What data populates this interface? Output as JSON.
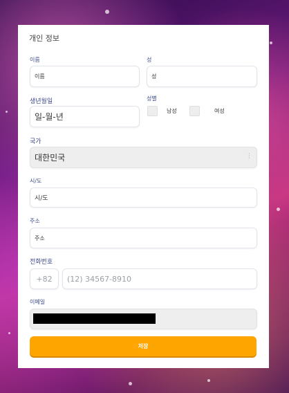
{
  "form": {
    "title": "개인 정보",
    "first_name": {
      "label": "이름",
      "placeholder": "이름"
    },
    "last_name": {
      "label": "성",
      "placeholder": "성"
    },
    "birthdate": {
      "label": "생년월일",
      "placeholder": "일-월-년"
    },
    "gender": {
      "label": "성별",
      "options": [
        "남성",
        "여성"
      ]
    },
    "country": {
      "label": "국가",
      "value": "대한민국"
    },
    "city": {
      "label": "시/도",
      "value": "시/도"
    },
    "address": {
      "label": "주소",
      "placeholder": "주소"
    },
    "phone": {
      "label": "전화번호",
      "code": "+82",
      "placeholder": "(12) 34567-8910"
    },
    "email": {
      "label": "이메일",
      "value": ""
    },
    "save_label": "저장"
  },
  "colors": {
    "accent": "#ffa500",
    "label": "#3c4a8a"
  },
  "icons": {
    "select": "vertical-dots-icon"
  }
}
